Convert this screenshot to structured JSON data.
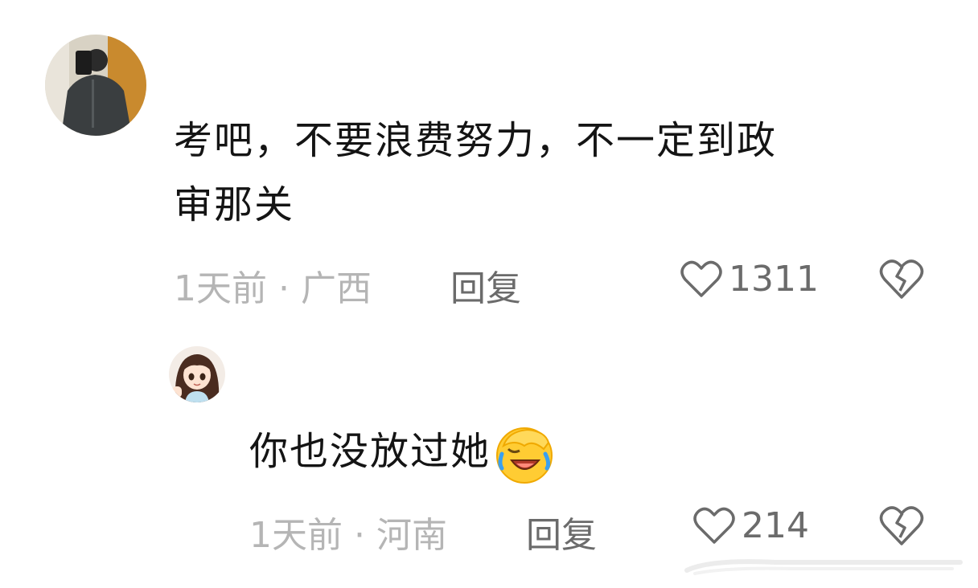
{
  "comments": [
    {
      "text_line1": "考吧，不要浪费努力，不一定到政",
      "text_line2": "审那关",
      "meta": "1天前 · 广西",
      "reply_label": "回复",
      "likes": "1311"
    }
  ],
  "replies": [
    {
      "text": "你也没放过她",
      "emoji": "face-palm-laughing-emoji",
      "meta": "1天前 · 河南",
      "reply_label": "回复",
      "likes": "214"
    }
  ],
  "icons": {
    "like": "heart-outline-icon",
    "dislike": "broken-heart-icon"
  },
  "colors": {
    "text": "#141414",
    "meta": "#b5b5b5",
    "action": "#6b6b6b"
  }
}
